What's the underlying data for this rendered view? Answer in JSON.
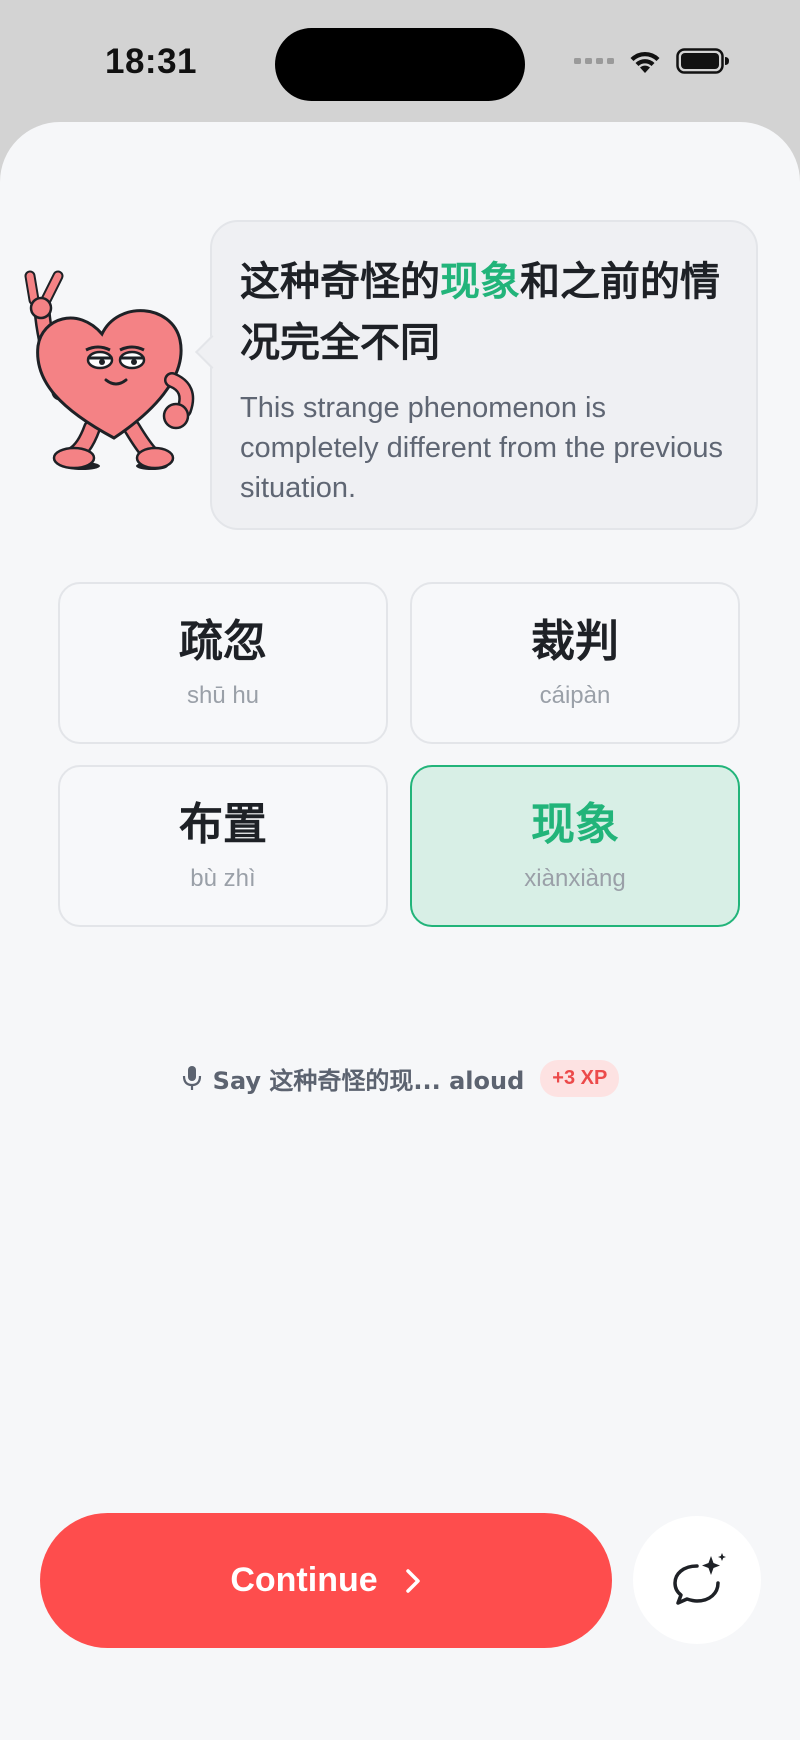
{
  "status_bar": {
    "time": "18:31",
    "icons": [
      "cellular-icon",
      "wifi-icon",
      "battery-icon"
    ]
  },
  "prompt": {
    "sentence_before": "这种奇怪的",
    "sentence_highlight": "现象",
    "sentence_after": "和之前的情况完全不同",
    "translation": "This strange phenomenon is completely different from the previous situation."
  },
  "options": [
    {
      "hanzi": "疏忽",
      "pinyin": "shū hu",
      "selected": false
    },
    {
      "hanzi": "裁判",
      "pinyin": "cáipàn",
      "selected": false
    },
    {
      "hanzi": "布置",
      "pinyin": "bù zhì",
      "selected": false
    },
    {
      "hanzi": "现象",
      "pinyin": "xiànxiàng",
      "selected": true
    }
  ],
  "speak": {
    "text": "Say 这种奇怪的现... aloud",
    "xp": "+3 XP",
    "icon": "microphone-icon"
  },
  "footer": {
    "continue_label": "Continue",
    "chat_icon": "chat-sparkle-icon"
  },
  "colors": {
    "accent_green": "#22b47a",
    "primary_red": "#fe4d4d",
    "selected_bg": "#d8efe6"
  }
}
